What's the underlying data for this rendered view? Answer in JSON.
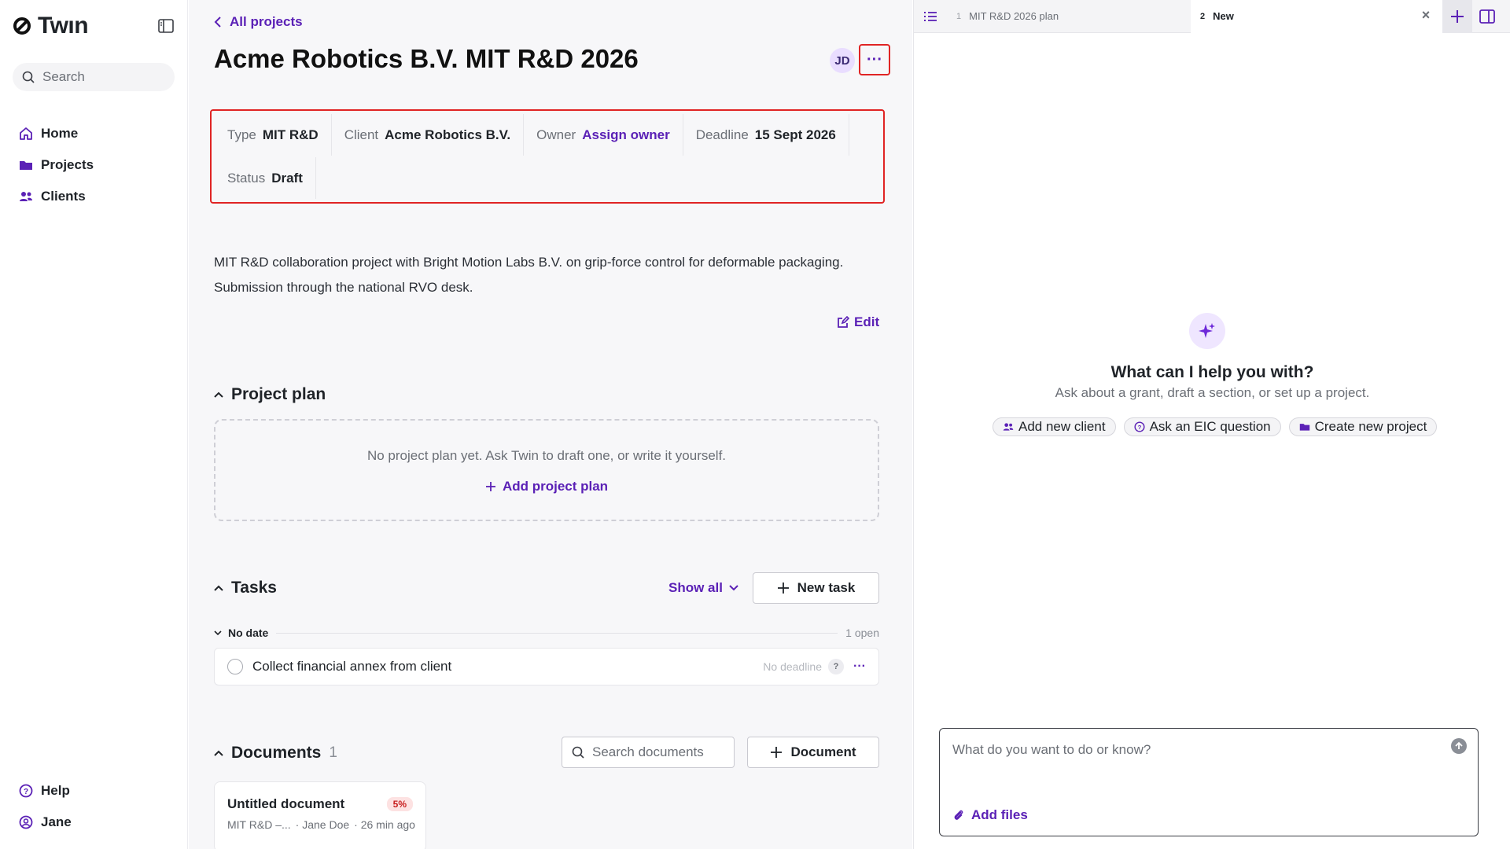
{
  "sidebar": {
    "brand": "Twın",
    "search_placeholder": "Search",
    "nav": [
      {
        "label": "Home",
        "icon": "home-icon"
      },
      {
        "label": "Projects",
        "icon": "folder-icon"
      },
      {
        "label": "Clients",
        "icon": "users-icon"
      }
    ],
    "bottom": [
      {
        "label": "Help",
        "icon": "help-icon"
      },
      {
        "label": "Jane",
        "icon": "user-icon"
      }
    ]
  },
  "header": {
    "back_label": "All projects",
    "title": "Acme Robotics B.V. MIT R&D 2026",
    "avatar_initials": "JD",
    "more_label": "···"
  },
  "meta": {
    "type_label": "Type",
    "type_value": "MIT R&D",
    "client_label": "Client",
    "client_value": "Acme Robotics B.V.",
    "owner_label": "Owner",
    "owner_value": "Assign owner",
    "deadline_label": "Deadline",
    "deadline_value": "15 Sept 2026",
    "status_label": "Status",
    "status_value": "Draft"
  },
  "description": {
    "line1": "MIT R&D collaboration project with Bright Motion Labs B.V. on grip-force control for deformable packaging.",
    "line2": "Submission through the national RVO desk.",
    "edit_label": "Edit"
  },
  "project_plan": {
    "title": "Project plan",
    "empty_text": "No project plan yet. Ask Twin to draft one, or write it yourself.",
    "add_label": "Add project plan"
  },
  "tasks": {
    "title": "Tasks",
    "show_all_label": "Show all",
    "new_task_label": "New task",
    "group_label": "No date",
    "group_count": "1 open",
    "items": [
      {
        "title": "Collect financial annex from client",
        "deadline": "No deadline",
        "badge": "?",
        "more": "···"
      }
    ]
  },
  "documents": {
    "title": "Documents",
    "count": "1",
    "search_placeholder": "Search documents",
    "add_label": "Document",
    "items": [
      {
        "title": "Untitled document",
        "progress": "5%",
        "type": "MIT R&D –...",
        "author": "· Jane Doe",
        "time": "· 26 min ago"
      }
    ]
  },
  "panel": {
    "tabs": [
      {
        "num": "1",
        "label": "MIT R&D 2026 plan"
      },
      {
        "num": "2",
        "label": "New"
      }
    ],
    "close_label": "×",
    "help_title": "What can I help you with?",
    "help_subtitle": "Ask about a grant, draft a section, or set up a project.",
    "chips": [
      {
        "label": "Add new client",
        "icon": "users-icon"
      },
      {
        "label": "Ask an EIC question",
        "icon": "help-icon"
      },
      {
        "label": "Create new project",
        "icon": "folder-icon"
      }
    ],
    "composer_placeholder": "What do you want to do or know?",
    "add_files_label": "Add files"
  },
  "colors": {
    "accent": "#5b21b6",
    "highlight_border": "#e02424",
    "sparkle_bg": "#efe6ff"
  }
}
